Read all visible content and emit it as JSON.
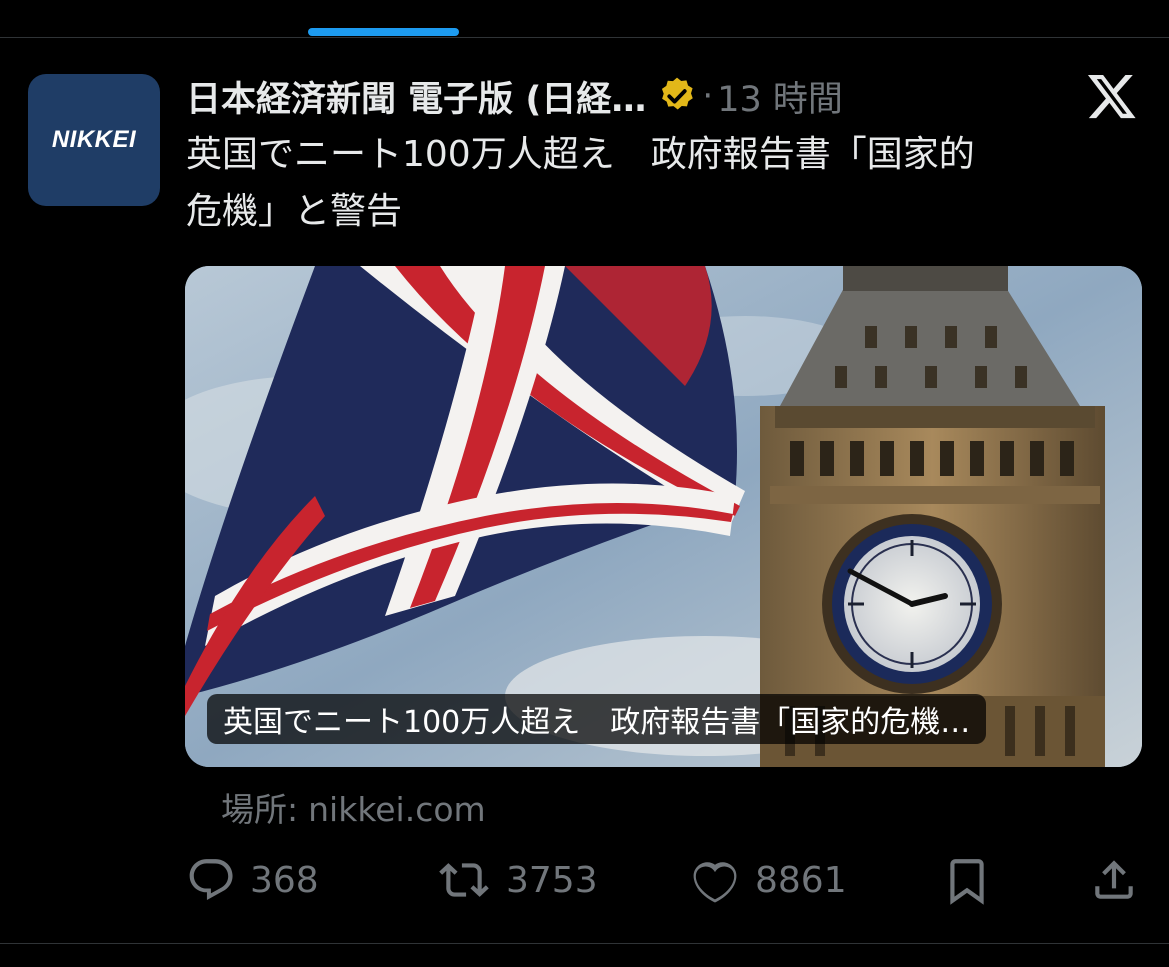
{
  "tab": {
    "active_indicator_color": "#1d9bf0"
  },
  "author": {
    "avatar_text": "NIKKEI",
    "avatar_bg": "#1f3d66",
    "name": "日本経済新聞 電子版 (日経…",
    "verified_badge": "gold-verified-badge-icon",
    "separator": "·",
    "time": "13 時間"
  },
  "close_icon": "x-logo-icon",
  "tweet": {
    "text": "英国でニート100万人超え　政府報告書「国家的\n危機」と警告"
  },
  "card": {
    "image": "union-jack-and-big-ben-photo",
    "overlay_title": "英国でニート100万人超え　政府報告書「国家的危機…"
  },
  "source": {
    "label": "場所:",
    "domain": "nikkei.com"
  },
  "actions": {
    "reply": {
      "icon": "reply-icon",
      "count": "368"
    },
    "retweet": {
      "icon": "retweet-icon",
      "count": "3753"
    },
    "like": {
      "icon": "heart-icon",
      "count": "8861"
    },
    "bookmark": {
      "icon": "bookmark-icon"
    },
    "share": {
      "icon": "share-icon"
    }
  },
  "colors": {
    "background": "#000000",
    "text": "#e7e9ea",
    "muted": "#71767b",
    "divider": "#2f3336"
  }
}
